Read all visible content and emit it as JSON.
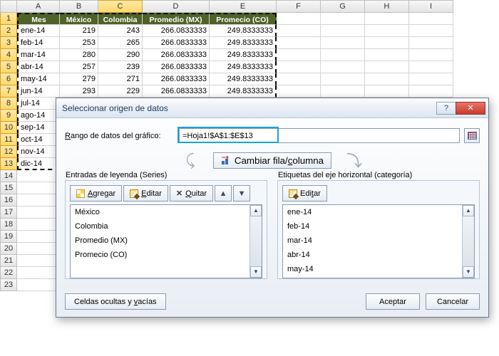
{
  "columns": [
    "A",
    "B",
    "C",
    "D",
    "E",
    "F",
    "G",
    "H",
    "I"
  ],
  "selected_column_index": 2,
  "headers": {
    "A": "Mes",
    "B": "México",
    "C": "Colombia",
    "D": "Promedio (MX)",
    "E": "Promecio (CO)"
  },
  "rows": [
    {
      "A": "ene-14",
      "B": "219",
      "C": "243",
      "D": "266.0833333",
      "E": "249.8333333"
    },
    {
      "A": "feb-14",
      "B": "253",
      "C": "265",
      "D": "266.0833333",
      "E": "249.8333333"
    },
    {
      "A": "mar-14",
      "B": "280",
      "C": "290",
      "D": "266.0833333",
      "E": "249.8333333"
    },
    {
      "A": "abr-14",
      "B": "257",
      "C": "239",
      "D": "266.0833333",
      "E": "249.8333333"
    },
    {
      "A": "may-14",
      "B": "279",
      "C": "271",
      "D": "266.0833333",
      "E": "249.8333333"
    },
    {
      "A": "jun-14",
      "B": "293",
      "C": "229",
      "D": "266.0833333",
      "E": "249.8333333"
    },
    {
      "A": "jul-14"
    },
    {
      "A": "ago-14"
    },
    {
      "A": "sep-14"
    },
    {
      "A": "oct-14"
    },
    {
      "A": "nov-14"
    },
    {
      "A": "dic-14"
    }
  ],
  "dialog": {
    "title": "Seleccionar origen de datos",
    "range_label_pre": "R",
    "range_label_mid": "ango de datos del gráfico:",
    "range_label_underline": "R",
    "range_value": "=Hoja1!$A$1:$E$13",
    "swap_label_pre": "Cambiar fila/",
    "swap_label_under": "c",
    "swap_label_post": "olumna",
    "series_panel_label": "Entradas de leyenda (Series)",
    "cats_panel_label": "Etiquetas del eje horizontal (categoría)",
    "btn_add_pre": "",
    "btn_add_under": "A",
    "btn_add_post": "gregar",
    "btn_edit_pre": "",
    "btn_edit_under": "E",
    "btn_edit_post": "ditar",
    "btn_remove_pre": "",
    "btn_remove_under": "Q",
    "btn_remove_post": "uitar",
    "btn_edit2_pre": "Edi",
    "btn_edit2_under": "t",
    "btn_edit2_post": "ar",
    "series": [
      "México",
      "Colombia",
      "Promedio (MX)",
      "Promecio (CO)"
    ],
    "categories": [
      "ene-14",
      "feb-14",
      "mar-14",
      "abr-14",
      "may-14"
    ],
    "hidden_btn_pre": "Celdas ocultas y ",
    "hidden_btn_under": "v",
    "hidden_btn_post": "acías",
    "ok": "Aceptar",
    "cancel": "Cancelar"
  }
}
